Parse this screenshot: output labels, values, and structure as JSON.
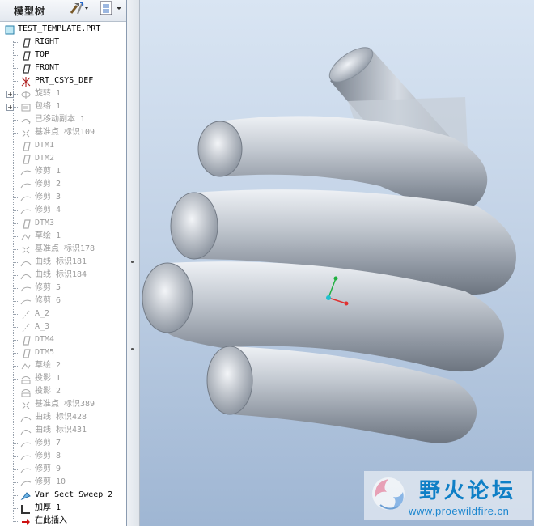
{
  "panel": {
    "title": "模型树",
    "tools_icon": "tools-icon",
    "show_icon": "tree-settings-icon"
  },
  "tree": [
    {
      "label": "TEST_TEMPLATE.PRT",
      "icon": "part-icon",
      "dim": false
    },
    {
      "label": "RIGHT",
      "icon": "datum-plane-icon",
      "dim": false
    },
    {
      "label": "TOP",
      "icon": "datum-plane-icon",
      "dim": false
    },
    {
      "label": "FRONT",
      "icon": "datum-plane-icon",
      "dim": false
    },
    {
      "label": "PRT_CSYS_DEF",
      "icon": "csys-icon",
      "dim": false
    },
    {
      "label": "旋转 1",
      "icon": "revolve-icon",
      "dim": true,
      "expand": true
    },
    {
      "label": "包络 1",
      "icon": "wrap-icon",
      "dim": true,
      "expand": true
    },
    {
      "label": "已移动副本 1",
      "icon": "moved-copy-icon",
      "dim": true
    },
    {
      "label": "基准点 标识109",
      "icon": "datum-point-icon",
      "dim": true
    },
    {
      "label": "DTM1",
      "icon": "datum-plane-icon",
      "dim": true
    },
    {
      "label": "DTM2",
      "icon": "datum-plane-icon",
      "dim": true
    },
    {
      "label": "修剪 1",
      "icon": "trim-icon",
      "dim": true
    },
    {
      "label": "修剪 2",
      "icon": "trim-icon",
      "dim": true
    },
    {
      "label": "修剪 3",
      "icon": "trim-icon",
      "dim": true
    },
    {
      "label": "修剪 4",
      "icon": "trim-icon",
      "dim": true
    },
    {
      "label": "DTM3",
      "icon": "datum-plane-icon",
      "dim": true
    },
    {
      "label": "草绘 1",
      "icon": "sketch-icon",
      "dim": true
    },
    {
      "label": "基准点 标识178",
      "icon": "datum-point-icon",
      "dim": true
    },
    {
      "label": "曲线 标识181",
      "icon": "curve-icon",
      "dim": true
    },
    {
      "label": "曲线 标识184",
      "icon": "curve-icon",
      "dim": true
    },
    {
      "label": "修剪 5",
      "icon": "trim-icon",
      "dim": true
    },
    {
      "label": "修剪 6",
      "icon": "trim-icon",
      "dim": true
    },
    {
      "label": "A_2",
      "icon": "datum-axis-icon",
      "dim": true
    },
    {
      "label": "A_3",
      "icon": "datum-axis-icon",
      "dim": true
    },
    {
      "label": "DTM4",
      "icon": "datum-plane-icon",
      "dim": true
    },
    {
      "label": "DTM5",
      "icon": "datum-plane-icon",
      "dim": true
    },
    {
      "label": "草绘 2",
      "icon": "sketch-icon",
      "dim": true
    },
    {
      "label": "投影 1",
      "icon": "projection-icon",
      "dim": true
    },
    {
      "label": "投影 2",
      "icon": "projection-icon",
      "dim": true
    },
    {
      "label": "基准点 标识389",
      "icon": "datum-point-icon",
      "dim": true
    },
    {
      "label": "曲线 标识428",
      "icon": "curve-icon",
      "dim": true
    },
    {
      "label": "曲线 标识431",
      "icon": "curve-icon",
      "dim": true
    },
    {
      "label": "修剪 7",
      "icon": "trim-icon",
      "dim": true
    },
    {
      "label": "修剪 8",
      "icon": "trim-icon",
      "dim": true
    },
    {
      "label": "修剪 9",
      "icon": "trim-icon",
      "dim": true
    },
    {
      "label": "修剪 10",
      "icon": "trim-icon",
      "dim": true
    },
    {
      "label": "Var Sect Sweep 2",
      "icon": "sweep-icon",
      "dim": false
    },
    {
      "label": "加厚 1",
      "icon": "thicken-icon",
      "dim": false
    },
    {
      "label": "在此插入",
      "icon": "insert-here-icon",
      "dim": false
    }
  ],
  "watermark": {
    "title": "野火论坛",
    "url": "www.proewildfire.cn"
  },
  "colors": {
    "viewport_top": "#d9e5f3",
    "viewport_bottom": "#9fb6d3",
    "tube": "#b9c0c9",
    "axis_x": "#e03030",
    "axis_y": "#20b040",
    "axis_origin": "#20c0d0"
  }
}
